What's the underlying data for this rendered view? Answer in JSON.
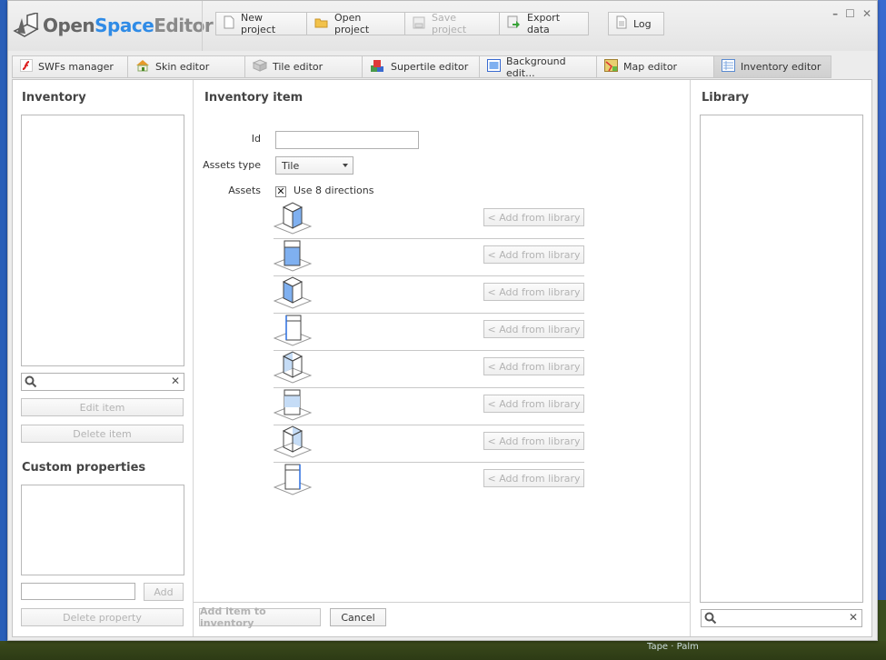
{
  "app": {
    "logo": {
      "open": "Open",
      "space": "Space",
      "editor": "Editor"
    },
    "window_controls": [
      "minimize",
      "maximize",
      "close"
    ]
  },
  "toolbar": {
    "new_project": "New project",
    "open_project": "Open project",
    "save_project": "Save project",
    "export_data": "Export data",
    "log": "Log"
  },
  "tabs": [
    {
      "label": "SWFs manager",
      "icon": "flash-icon"
    },
    {
      "label": "Skin editor",
      "icon": "house-icon"
    },
    {
      "label": "Tile editor",
      "icon": "tile-icon"
    },
    {
      "label": "Supertile editor",
      "icon": "supertile-icon"
    },
    {
      "label": "Background edit...",
      "icon": "background-icon"
    },
    {
      "label": "Map editor",
      "icon": "map-icon"
    },
    {
      "label": "Inventory editor",
      "icon": "inventory-icon",
      "active": true
    }
  ],
  "inventory": {
    "title": "Inventory",
    "search_placeholder": "",
    "edit_item": "Edit item",
    "delete_item": "Delete item",
    "custom_properties_title": "Custom properties",
    "property_input_value": "",
    "add": "Add",
    "delete_property": "Delete property"
  },
  "item": {
    "title": "Inventory item",
    "id_label": "Id",
    "id_value": "",
    "assets_type_label": "Assets type",
    "assets_type_value": "Tile",
    "assets_label": "Assets",
    "use8_label": "Use 8 directions",
    "use8_checked": true,
    "check_mark": "✕",
    "add_from_library": "< Add from library",
    "directions": [
      "dir-1",
      "dir-2",
      "dir-3",
      "dir-4",
      "dir-5",
      "dir-6",
      "dir-7",
      "dir-8"
    ],
    "add_to_inventory": "Add item to inventory",
    "cancel": "Cancel"
  },
  "library": {
    "title": "Library",
    "search_placeholder": ""
  },
  "colors": {
    "accent_blue": "#2f8be6",
    "highlight_face": "#7fb0f0",
    "highlight_face_light": "#c5dcf6"
  },
  "desktop": {
    "taskbar_text": "Tape · Palm"
  }
}
